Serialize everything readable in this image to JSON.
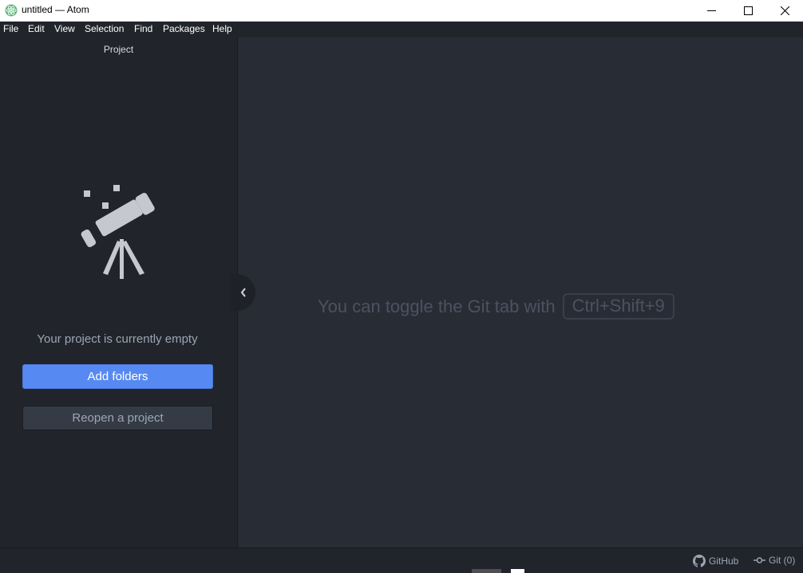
{
  "window": {
    "title": "untitled — Atom"
  },
  "menu": {
    "items": [
      "File",
      "Edit",
      "View",
      "Selection",
      "Find",
      "Packages",
      "Help"
    ]
  },
  "project_panel": {
    "title": "Project",
    "empty_message": "Your project is currently empty",
    "add_folders_label": "Add folders",
    "reopen_label": "Reopen a project"
  },
  "main": {
    "hint_text": "You can toggle the Git tab with",
    "shortcut": "Ctrl+Shift+9"
  },
  "statusbar": {
    "github_label": "GitHub",
    "git_label": "Git (0)"
  },
  "colors": {
    "accent": "#568af2",
    "panel_bg": "#21252b",
    "editor_bg": "#282c34"
  },
  "icons": {
    "app": "atom-logo-icon",
    "illustration": "telescope-icon",
    "collapse": "chevron-left-icon",
    "github": "github-icon",
    "git": "git-commit-icon"
  }
}
